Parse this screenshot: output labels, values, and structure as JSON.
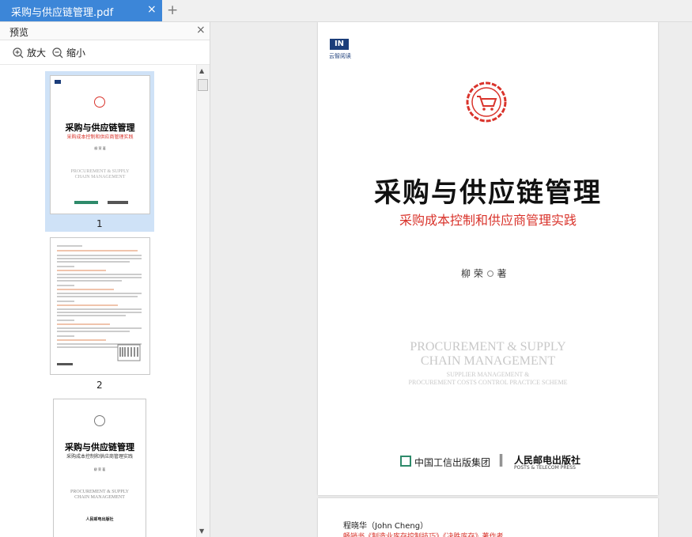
{
  "tab": {
    "title": "采购与供应链管理.pdf",
    "close": "×",
    "add": "+"
  },
  "sidebar": {
    "title": "预览",
    "close": "×",
    "zoom_in": "放大",
    "zoom_out": "缩小",
    "pages": [
      {
        "number": "1",
        "title": "采购与供应链管理",
        "subtitle": "采购成本控制和供应商管理实践",
        "author": "柳 荣 著",
        "en1": "PROCUREMENT & SUPPLY",
        "en2": "CHAIN MANAGEMENT"
      },
      {
        "number": "2"
      },
      {
        "number": "",
        "title": "采购与供应链管理",
        "subtitle": "采购成本控制和供应商管理实践",
        "author": "柳 荣 著",
        "en1": "PROCUREMENT & SUPPLY",
        "en2": "CHAIN MANAGEMENT",
        "publisher": "人民邮电出版社"
      }
    ]
  },
  "cover": {
    "logo_mark": "IN",
    "logo_text": "云智阅读",
    "title": "采购与供应链管理",
    "subtitle": "采购成本控制和供应商管理实践",
    "author": "柳 荣",
    "author_suffix": "著",
    "en_title_1": "PROCUREMENT & SUPPLY",
    "en_title_2": "CHAIN MANAGEMENT",
    "en_sub_1": "SUPPLIER MANAGEMENT &",
    "en_sub_2": "PROCUREMENT COSTS CONTROL PRACTICE SCHEME",
    "publisher_1": "中国工信出版集团",
    "publisher_2": "人民邮电出版社",
    "publisher_2_en": "POSTS & TELECOM PRESS"
  },
  "next_page": {
    "line1": "程晓华（John Cheng）",
    "line2": "畅销书《制造业库存控制技巧》《决胜库存》著作者"
  },
  "colors": {
    "tab_active": "#3c86d8",
    "selected_thumb": "#cfe2f7",
    "accent_red": "#d9332b"
  }
}
